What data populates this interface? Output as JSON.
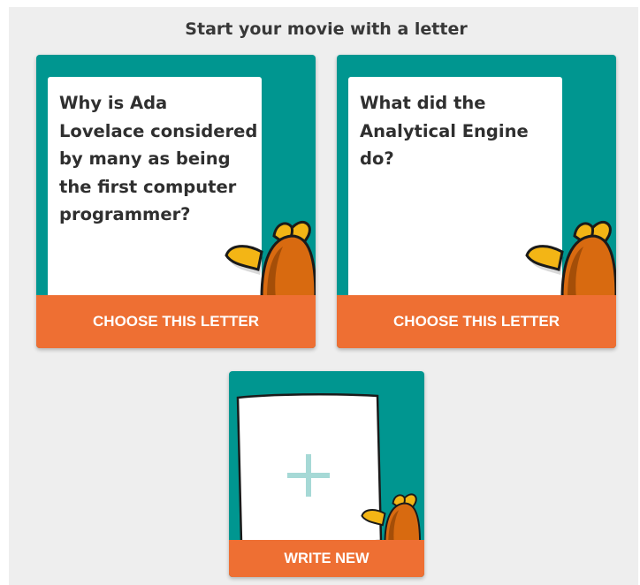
{
  "header": {
    "title": "Start your movie with a letter"
  },
  "letters": [
    {
      "text": "Why is Ada Lovelace considered by many as being the first computer programmer?",
      "action_label": "CHOOSE THIS LETTER"
    },
    {
      "text": "What did the Analytical Engine do?",
      "action_label": "CHOOSE THIS LETTER"
    }
  ],
  "new_letter": {
    "icon": "plus-icon",
    "action_label": "WRITE NEW"
  },
  "colors": {
    "card_background": "#009690",
    "action_bar": "#ee6f33",
    "panel_background": "#eeeeee",
    "plus_icon": "#a6d9d6",
    "mascot_orange": "#d86a10",
    "mascot_yellow": "#f3b515"
  }
}
